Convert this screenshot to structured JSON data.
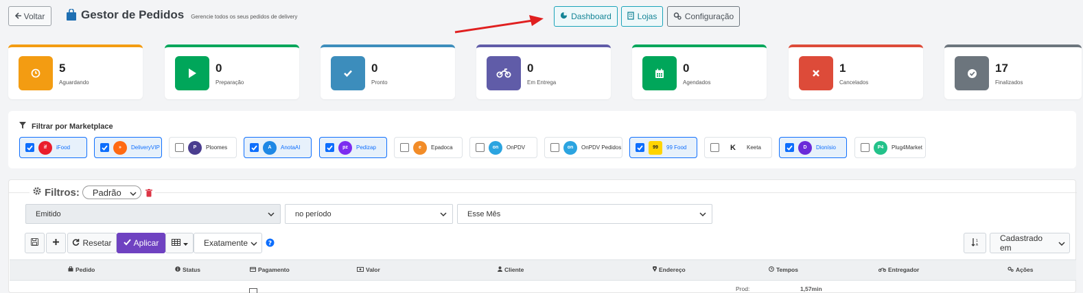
{
  "header": {
    "back_label": "Voltar",
    "title": "Gestor de Pedidos",
    "subtitle": "Gerencie todos os seus pedidos de delivery",
    "nav": {
      "dashboard": "Dashboard",
      "lojas": "Lojas",
      "configuracao": "Configuração"
    }
  },
  "status_cards": [
    {
      "value": "5",
      "label": "Aguardando",
      "color": "#f39c12",
      "icon": "clock-icon"
    },
    {
      "value": "0",
      "label": "Preparação",
      "color": "#00a65a",
      "icon": "play-icon"
    },
    {
      "value": "0",
      "label": "Pronto",
      "color": "#3c8dbc",
      "icon": "check-icon"
    },
    {
      "value": "0",
      "label": "Em Entrega",
      "color": "#605ca8",
      "icon": "motorcycle-icon"
    },
    {
      "value": "0",
      "label": "Agendados",
      "color": "#00a65a",
      "icon": "calendar-icon"
    },
    {
      "value": "1",
      "label": "Cancelados",
      "color": "#dd4b39",
      "icon": "x-icon"
    },
    {
      "value": "17",
      "label": "Finalizados",
      "color": "#6c757d",
      "icon": "check-circle-icon"
    }
  ],
  "marketplace_filter": {
    "title": "Filtrar por Marketplace",
    "items": [
      {
        "name": "iFood",
        "checked": true,
        "logo_color": "#ea1d2c",
        "logo_text": "if"
      },
      {
        "name": "DeliveryVIP",
        "checked": true,
        "logo_color": "#ff6a13",
        "logo_text": "»"
      },
      {
        "name": "Ploomes",
        "checked": false,
        "logo_color": "#4a3d8f",
        "logo_text": "P"
      },
      {
        "name": "AnotaAI",
        "checked": true,
        "logo_color": "#1e88e5",
        "logo_text": "A"
      },
      {
        "name": "Pedizap",
        "checked": true,
        "logo_color": "#7c2cf0",
        "logo_text": "pz"
      },
      {
        "name": "Epadoca",
        "checked": false,
        "logo_color": "#f28c28",
        "logo_text": "e"
      },
      {
        "name": "OnPDV",
        "checked": false,
        "logo_color": "#2ba4e0",
        "logo_text": "on"
      },
      {
        "name": "OnPDV Pedidos",
        "checked": false,
        "logo_color": "#2ba4e0",
        "logo_text": "on"
      },
      {
        "name": "99 Food",
        "checked": true,
        "logo_color": "#ffd400",
        "logo_text": "99"
      },
      {
        "name": "Keeta",
        "checked": false,
        "logo_color": "#222222",
        "logo_text": "K"
      },
      {
        "name": "Dionísio",
        "checked": true,
        "logo_color": "#6a2bd9",
        "logo_text": "D"
      },
      {
        "name": "Plug4Market",
        "checked": false,
        "logo_color": "#23c28a",
        "logo_text": "P4"
      }
    ]
  },
  "filters": {
    "title": "Filtros:",
    "preset": "Padrão",
    "date_field": "Emitido",
    "period_mode": "no período",
    "period_value": "Esse Mês",
    "reset_label": "Resetar",
    "apply_label": "Aplicar",
    "match_mode": "Exatamente",
    "sort_field": "Cadastrado em"
  },
  "table": {
    "columns": [
      "Pedido",
      "Status",
      "Pagamento",
      "Valor",
      "Cliente",
      "Endereço",
      "Tempos",
      "Entregador",
      "Ações"
    ],
    "peek_row": {
      "label": "Prod:",
      "value": "1,57min"
    }
  }
}
